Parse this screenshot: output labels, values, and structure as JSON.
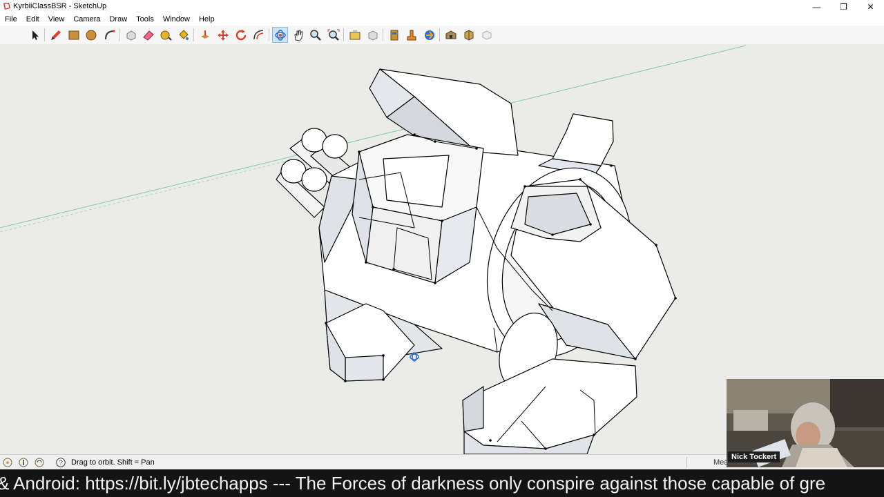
{
  "window": {
    "title": "KyrbiiClassBSR - SketchUp",
    "controls": {
      "minimize": "—",
      "restore": "❐",
      "close": "✕"
    }
  },
  "menu": [
    "File",
    "Edit",
    "View",
    "Camera",
    "Draw",
    "Tools",
    "Window",
    "Help"
  ],
  "toolbar": {
    "tools": [
      "select-icon",
      "pencil-icon",
      "rectangle-icon",
      "circle-icon",
      "arc-icon",
      "make-component-icon",
      "eraser-icon",
      "tape-measure-icon",
      "paint-bucket-icon",
      "push-pull-icon",
      "move-icon",
      "rotate-icon",
      "offset-icon",
      "orbit-icon",
      "pan-icon",
      "zoom-icon",
      "zoom-extents-icon",
      "get-models-icon",
      "share-model-icon",
      "extension-warehouse-icon",
      "layout-icon",
      "send-to-layout-icon",
      "3d-warehouse-icon",
      "component-options-icon",
      "components-icon",
      "styles-icon"
    ],
    "active_tool": "orbit-icon"
  },
  "status": {
    "hint": "Drag to orbit.  Shift = Pan",
    "measurements_label": "Mea"
  },
  "webcam": {
    "name": "Nick Tockert"
  },
  "ticker": {
    "text": "& Android: https://bit.ly/jbtechapps --- The Forces of darkness only conspire against those capable of gre"
  },
  "colors": {
    "viewport_bg": "#ebebea",
    "face": "#ffffff",
    "face_shade": "#d9dde2",
    "edge": "#000000",
    "axis_green": "#7fc9a0",
    "ticker_bg": "#141414"
  }
}
